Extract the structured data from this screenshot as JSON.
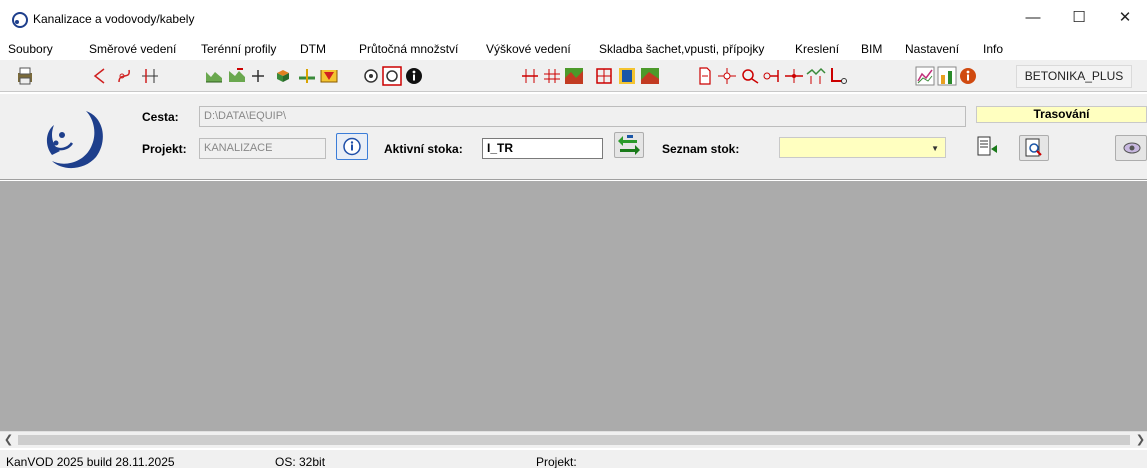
{
  "window": {
    "title": "Kanalizace a vodovody/kabely",
    "minimize": "—",
    "maximize": "☐",
    "close": "✕"
  },
  "menu": {
    "items": [
      "Soubory",
      "Směrové vedení",
      "Terénní profily",
      "DTM",
      "Průtočná množství",
      "Výškové vedení",
      "Skladba šachet,vpusti, přípojky",
      "Kreslení",
      "BIM",
      "Nastavení",
      "Info"
    ]
  },
  "toolbar": {
    "profile_button": "BETONIKA_PLUS"
  },
  "panel": {
    "cesta_label": "Cesta:",
    "cesta_value": "D:\\DATA\\EQUIP\\",
    "projekt_label": "Projekt:",
    "projekt_value": "KANALIZACE",
    "aktivni_label": "Aktivní stoka:",
    "aktivni_value": "I_TR",
    "seznam_label": "Seznam stok:",
    "seznam_value": "",
    "mode": "Trasování"
  },
  "statusbar": {
    "version": "KanVOD 2025 build 28.11.2025",
    "os": "OS:  32bit",
    "project": "Projekt:"
  },
  "colors": {
    "workarea": "#ababab",
    "highlight_yellow": "#ffffc0",
    "logo_blue": "#1e3f8c"
  }
}
